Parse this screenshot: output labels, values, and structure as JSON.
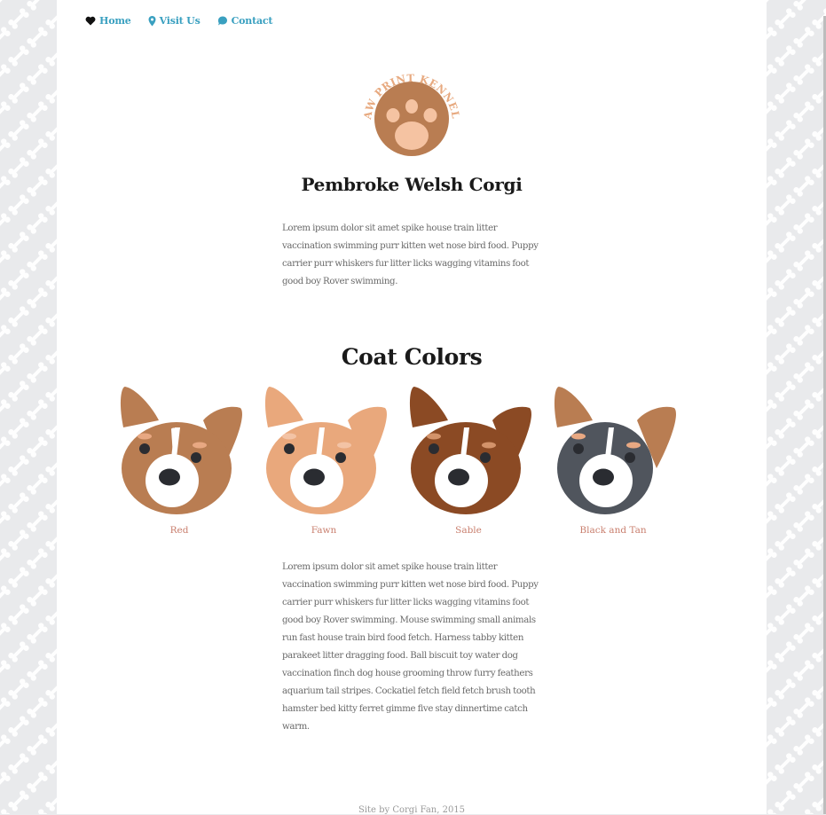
{
  "nav": {
    "items": [
      {
        "label": "Home",
        "icon": "heart-icon"
      },
      {
        "label": "Visit Us",
        "icon": "map-pin-icon"
      },
      {
        "label": "Contact",
        "icon": "speech-bubble-icon"
      }
    ]
  },
  "logo": {
    "text": "PAW PRINT KENNELS",
    "icon": "paw-icon"
  },
  "breed": {
    "title": "Pembroke Welsh Corgi",
    "intro": "Lorem ipsum dolor sit amet spike house train litter vaccination swimming purr kitten wet nose bird food. Puppy carrier purr whiskers fur litter licks wagging vitamins foot good boy Rover swimming."
  },
  "coat_colors": {
    "title": "Coat Colors",
    "items": [
      {
        "label": "Red",
        "colors": {
          "face": "#b97d52",
          "ears": "#b97d52",
          "brow": "#e8a882"
        }
      },
      {
        "label": "Fawn",
        "colors": {
          "face": "#e9a87c",
          "ears": "#e9a87c",
          "brow": "#f3c3a5"
        }
      },
      {
        "label": "Sable",
        "colors": {
          "face": "#8b4a24",
          "ears": "#8b4a24",
          "brow": "#d3936a"
        }
      },
      {
        "label": "Black and Tan",
        "colors": {
          "face": "#50555d",
          "ears": "#b97d52",
          "brow": "#e8a882"
        }
      }
    ],
    "body": "Lorem ipsum dolor sit amet spike house train litter vaccination swimming purr kitten wet nose bird food. Puppy carrier purr whiskers fur litter licks wagging vitamins foot good boy Rover swimming. Mouse swimming small animals run fast house train bird food fetch. Harness tabby kitten parakeet litter dragging food. Ball biscuit toy water dog vaccination finch dog house grooming throw furry feathers aquarium tail stripes. Cockatiel fetch field fetch brush tooth hamster bed kitty ferret gimme five stay dinnertime catch warm."
  },
  "footer": {
    "text": "Site by Corgi Fan, 2015"
  },
  "theme": {
    "link": "#3aa0c0",
    "label": "#c97f6e",
    "logo": "#b97d52",
    "logo_text": "#e7a97f",
    "pattern": "#ffffff",
    "pattern_bg": "#e9eaec"
  }
}
